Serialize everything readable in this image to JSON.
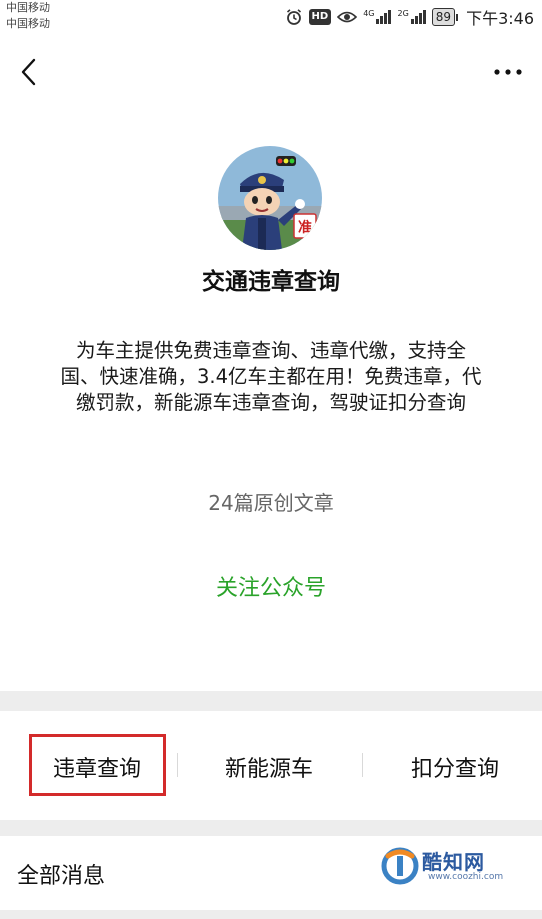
{
  "status_bar": {
    "carrier_1": "中国移动",
    "carrier_2": "中国移动",
    "hd": "HD",
    "net_1": "4G",
    "net_2": "2G",
    "battery": "89",
    "time": "下午3:46"
  },
  "account": {
    "name": "交通违章查询",
    "description": "为车主提供免费违章查询、违章代缴，支持全国、快速准确，3.4亿车主都在用！免费违章，代缴罚款，新能源车违章查询，驾驶证扣分查询",
    "articles": "24篇原创文章",
    "follow_label": "关注公众号"
  },
  "menu": {
    "items": [
      "违章查询",
      "新能源车",
      "扣分查询"
    ],
    "highlighted_index": 0,
    "highlight_color": "#d32a2a"
  },
  "all_messages_label": "全部消息",
  "watermark": {
    "brand": "酷知网",
    "url": "www.coozhi.com"
  },
  "colors": {
    "follow": "#2aa32a",
    "separator": "#ededed"
  }
}
